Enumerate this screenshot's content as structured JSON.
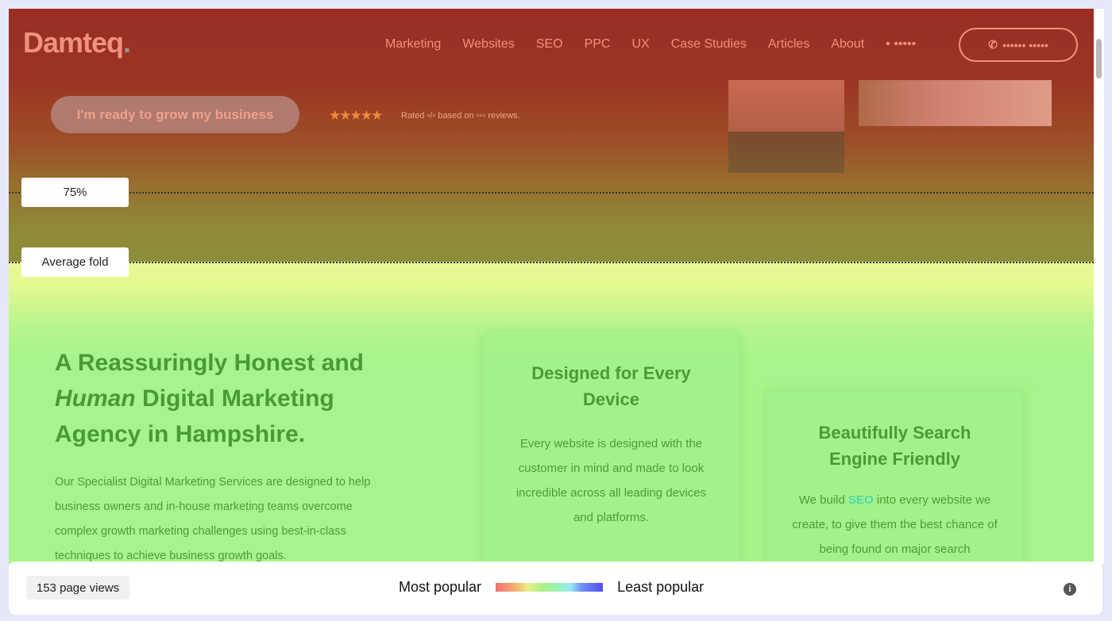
{
  "site": {
    "logo": "Damteq",
    "logo_dot": ".",
    "nav": [
      "Marketing",
      "Websites",
      "SEO",
      "PPC",
      "UX",
      "Case Studies",
      "Articles",
      "About",
      "• •••••"
    ],
    "phone_label": "•••••• •••••",
    "cta": "I'm ready to grow my business",
    "rating": {
      "stars": "★★★★★",
      "text": "Rated ▫/▫ based on ▫▫▫ reviews."
    },
    "headline": {
      "part1": "A Reassuringly Honest and ",
      "italic": "Human",
      "part2": " Digital Marketing Agency in Hampshire."
    },
    "intro": "Our Specialist Digital Marketing Services are designed to help business owners and in-house marketing teams overcome complex growth marketing challenges using best-in-class techniques to achieve business growth goals.",
    "cards": [
      {
        "title": "Designed for Every Device",
        "text": "Every website is designed with the customer in mind and made to look incredible across all leading devices and platforms."
      },
      {
        "title": "Beautifully Search Engine Friendly",
        "text_before": "We build ",
        "highlight": "SEO",
        "text_after": " into every website we create, to give them the best chance of being found on major search"
      }
    ]
  },
  "overlay": {
    "fold_75": "75%",
    "fold_avg": "Average fold"
  },
  "footer": {
    "views_count": "153",
    "views_label": "page views",
    "most": "Most popular",
    "least": "Least popular",
    "info": "i"
  },
  "colors": {
    "hot": "#9a2e23",
    "warm": "#8f8b38",
    "cool": "#a8f48c"
  }
}
